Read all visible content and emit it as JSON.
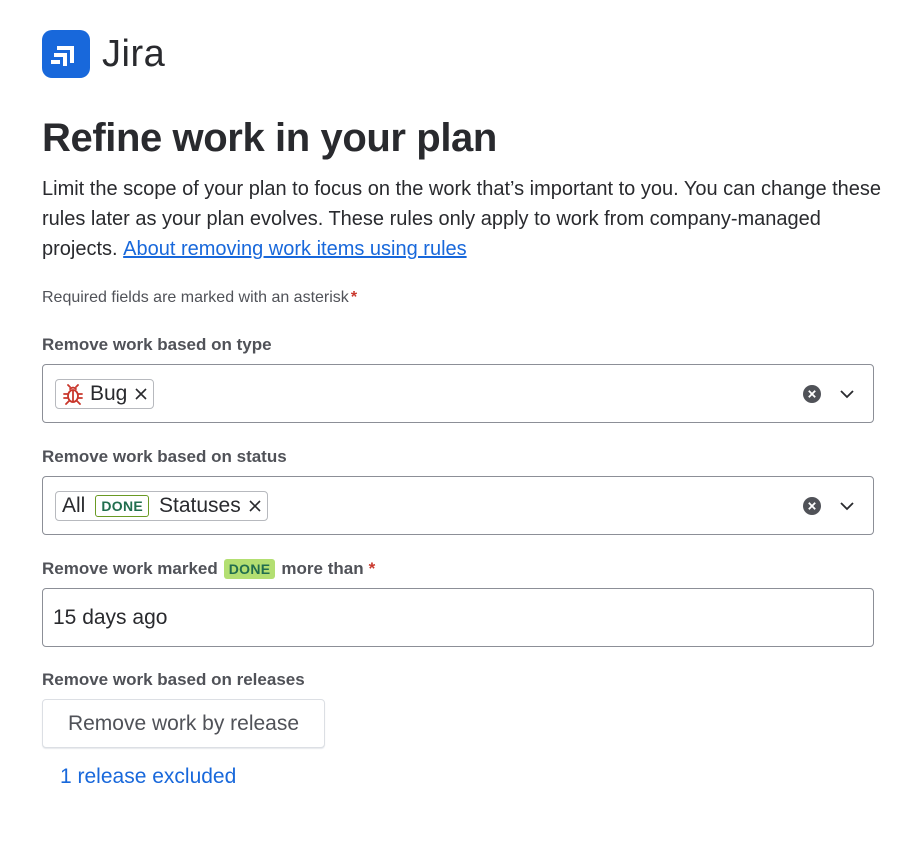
{
  "brand": {
    "name": "Jira",
    "color": "#1868db",
    "icon": "jira-logo-icon"
  },
  "heading": "Refine work in your plan",
  "description": {
    "text": "Limit the scope of your plan to focus on the work that’s important to you. You can change these rules later as your plan evolves. These rules only apply to work from company-managed projects.",
    "link": "About removing work items using rules"
  },
  "required_note": "Required fields are marked with an asterisk",
  "asterisk": "*",
  "type_field": {
    "label": "Remove work based on type",
    "chips": [
      {
        "label": "Bug",
        "icon": "bug-icon"
      }
    ]
  },
  "status_field": {
    "label": "Remove work based on status",
    "chip": {
      "prefix": "All",
      "lozenge": "DONE",
      "suffix": "Statuses"
    }
  },
  "done_field": {
    "label_before": "Remove work marked",
    "lozenge": "DONE",
    "label_after": "more than",
    "value": "15 days ago"
  },
  "releases_field": {
    "label": "Remove work based on releases",
    "button": "Remove work by release",
    "link": "1 release excluded"
  },
  "colors": {
    "link": "#1868db",
    "done_lozenge": "#b3df72",
    "required": "#c9372c"
  }
}
